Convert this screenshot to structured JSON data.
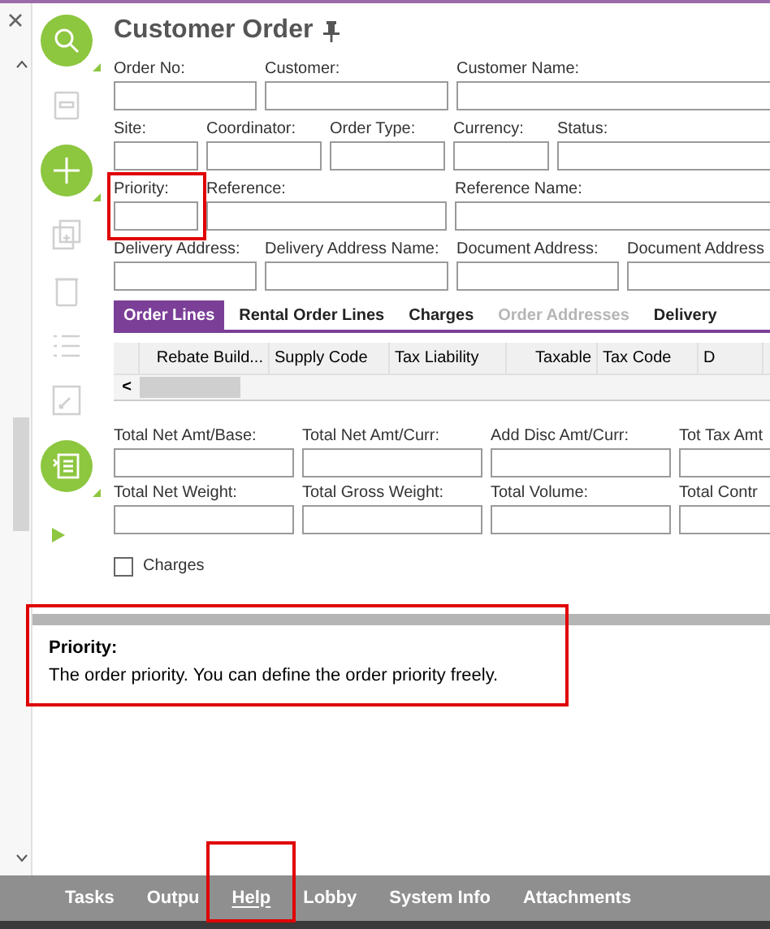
{
  "title": "Customer Order",
  "field_rows": [
    [
      {
        "label": "Order No:"
      },
      {
        "label": "Customer:"
      },
      {
        "label": "Customer Name:"
      }
    ],
    [
      {
        "label": "Site:"
      },
      {
        "label": "Coordinator:"
      },
      {
        "label": "Order Type:"
      },
      {
        "label": "Currency:"
      },
      {
        "label": "Status:"
      }
    ],
    [
      {
        "label": "Priority:"
      },
      {
        "label": "Reference:"
      },
      {
        "label": "Reference Name:"
      }
    ],
    [
      {
        "label": "Delivery Address:"
      },
      {
        "label": "Delivery Address Name:"
      },
      {
        "label": "Document Address:"
      },
      {
        "label": "Document Address"
      }
    ]
  ],
  "tabs": [
    {
      "label": "Order Lines",
      "selected": true,
      "disabled": false
    },
    {
      "label": "Rental Order Lines",
      "selected": false,
      "disabled": false
    },
    {
      "label": "Charges",
      "selected": false,
      "disabled": false
    },
    {
      "label": "Order Addresses",
      "selected": false,
      "disabled": true
    },
    {
      "label": "Delivery",
      "selected": false,
      "disabled": false
    }
  ],
  "table": {
    "columns": [
      "Rebate Build...",
      "Supply Code",
      "Tax Liability",
      "Taxable",
      "Tax Code",
      "D"
    ],
    "scroll_left": "<"
  },
  "total_rows": [
    [
      {
        "label": "Total Net Amt/Base:"
      },
      {
        "label": "Total Net Amt/Curr:"
      },
      {
        "label": "Add Disc Amt/Curr:"
      },
      {
        "label": "Tot Tax Amt"
      }
    ],
    [
      {
        "label": "Total Net Weight:"
      },
      {
        "label": "Total Gross Weight:"
      },
      {
        "label": "Total Volume:"
      },
      {
        "label": "Total Contr"
      }
    ]
  ],
  "charges_checkbox": {
    "label": "Charges",
    "checked": false
  },
  "help": {
    "title": "Priority:",
    "text": "The order priority. You can define the order priority freely."
  },
  "bottom_tabs": [
    {
      "label": "Tasks",
      "selected": false
    },
    {
      "label": "Outpu",
      "selected": false
    },
    {
      "label": "Help",
      "selected": true
    },
    {
      "label": "Lobby",
      "selected": false
    },
    {
      "label": "System Info",
      "selected": false
    },
    {
      "label": "Attachments",
      "selected": false
    }
  ]
}
